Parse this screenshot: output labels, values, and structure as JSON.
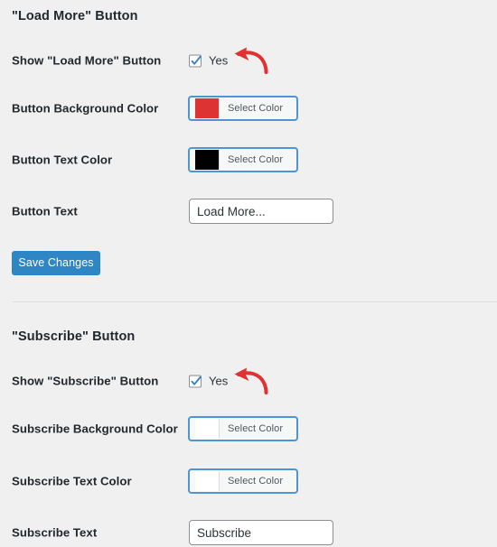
{
  "page": {
    "background_color": "#f0f0f1",
    "accent_blue": "#2e87c4",
    "annotation_color": "#e03232"
  },
  "sections": [
    {
      "heading": "\"Load More\" Button",
      "rows": [
        {
          "type": "checkbox",
          "label": "Show \"Load More\" Button",
          "checkbox_label": "Yes",
          "checked": true,
          "annotated": true
        },
        {
          "type": "color",
          "label": "Button Background Color",
          "button_label": "Select Color",
          "swatch_color": "#dd3333"
        },
        {
          "type": "color",
          "label": "Button Text Color",
          "button_label": "Select Color",
          "swatch_color": "#000000"
        },
        {
          "type": "text",
          "label": "Button Text",
          "value": "Load More...",
          "placeholder": ""
        }
      ],
      "submit_label": "Save Changes"
    },
    {
      "heading": "\"Subscribe\" Button",
      "rows": [
        {
          "type": "checkbox",
          "label": "Show \"Subscribe\" Button",
          "checkbox_label": "Yes",
          "checked": true,
          "annotated": true
        },
        {
          "type": "color",
          "label": "Subscribe Background Color",
          "button_label": "Select Color",
          "swatch_color": "#ffffff"
        },
        {
          "type": "color",
          "label": "Subscribe Text Color",
          "button_label": "Select Color",
          "swatch_color": "#ffffff"
        },
        {
          "type": "text",
          "label": "Subscribe Text",
          "value": "Subscribe",
          "placeholder": ""
        }
      ]
    }
  ],
  "icons": {
    "checkmark": "check-icon",
    "arrow": "curved-arrow-left-icon"
  }
}
